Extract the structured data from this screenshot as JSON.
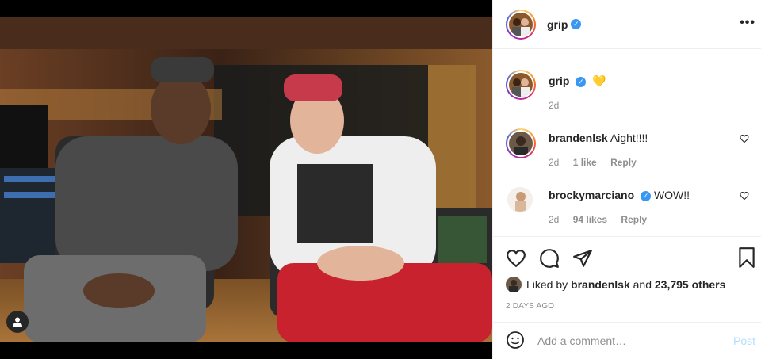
{
  "post": {
    "author": "grip",
    "caption_emoji": "💛",
    "caption_time": "2d"
  },
  "comments": [
    {
      "username": "brandenlsk",
      "text": "Aight!!!!",
      "time": "2d",
      "likes": "1 like",
      "reply": "Reply",
      "verified": false
    },
    {
      "username": "brockymarciano",
      "text": "WOW!!",
      "time": "2d",
      "likes": "94 likes",
      "reply": "Reply",
      "verified": true
    }
  ],
  "likes": {
    "prefix": "Liked by",
    "user": "brandenlsk",
    "middle": "and",
    "others": "23,795 others"
  },
  "date_label": "2 DAYS AGO",
  "add_comment": {
    "placeholder": "Add a comment…",
    "post_label": "Post"
  },
  "icons": {
    "more": "more-options-icon",
    "verified": "verified-badge-icon",
    "heart": "heart-icon",
    "comment": "comment-icon",
    "share": "share-icon",
    "bookmark": "bookmark-icon",
    "emoji": "emoji-icon",
    "tag": "user-tag-icon"
  },
  "colors": {
    "verified": "#3897f0",
    "muted": "#8e8e8e",
    "post_button_disabled": "#b2dffc"
  }
}
